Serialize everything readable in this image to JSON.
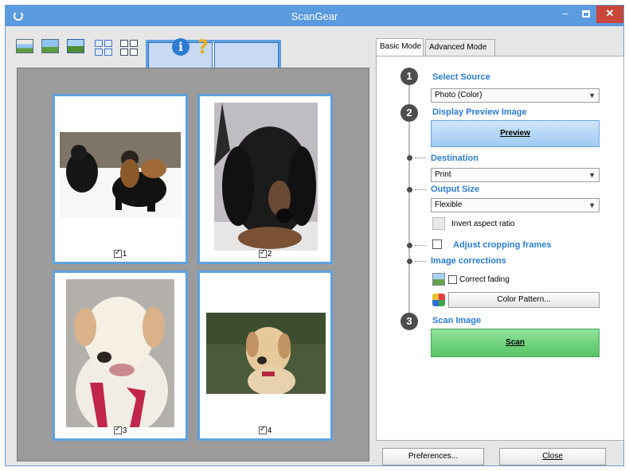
{
  "window": {
    "title": "ScanGear",
    "minimize_glyph": "–",
    "close_glyph": "✕"
  },
  "toolbar": {
    "icons": [
      "scan-icon",
      "preview-icon",
      "crop-icon",
      "multi-crop-icon",
      "grid-icon",
      "thumbnail-view-icon",
      "info-icon",
      "help-icon"
    ],
    "info_glyph": "i",
    "help_glyph": "?"
  },
  "thumbnails": [
    {
      "number": "1",
      "checked": true
    },
    {
      "number": "2",
      "checked": true
    },
    {
      "number": "3",
      "checked": true
    },
    {
      "number": "4",
      "checked": true
    }
  ],
  "tabs": [
    {
      "label": "Basic Mode",
      "active": true
    },
    {
      "label": "Advanced Mode",
      "active": false
    }
  ],
  "steps": {
    "step1": {
      "number": "1",
      "label": "Select Source"
    },
    "step2": {
      "number": "2",
      "label": "Display Preview Image"
    },
    "step3": {
      "number": "3",
      "label": "Scan Image"
    }
  },
  "source": {
    "value": "Photo (Color)"
  },
  "preview_button": {
    "label": "Preview"
  },
  "destination": {
    "label": "Destination",
    "value": "Print"
  },
  "output_size": {
    "label": "Output Size",
    "value": "Flexible"
  },
  "invert_aspect": {
    "label": "Invert aspect ratio"
  },
  "cropping": {
    "label": "Adjust cropping frames",
    "checked": false
  },
  "image_corrections": {
    "label": "Image corrections"
  },
  "correct_fading": {
    "label": "Correct fading",
    "checked": false
  },
  "color_pattern": {
    "label": "Color Pattern..."
  },
  "scan_button": {
    "label": "Scan"
  },
  "footer": {
    "preferences_label": "Preferences...",
    "close_label": "Close"
  },
  "colors": {
    "titlebar": "#5b9be0",
    "accent_text": "#2b7cd3",
    "preview_button": "#9fcaf2",
    "scan_button": "#56c465",
    "close_button": "#c8463a"
  }
}
